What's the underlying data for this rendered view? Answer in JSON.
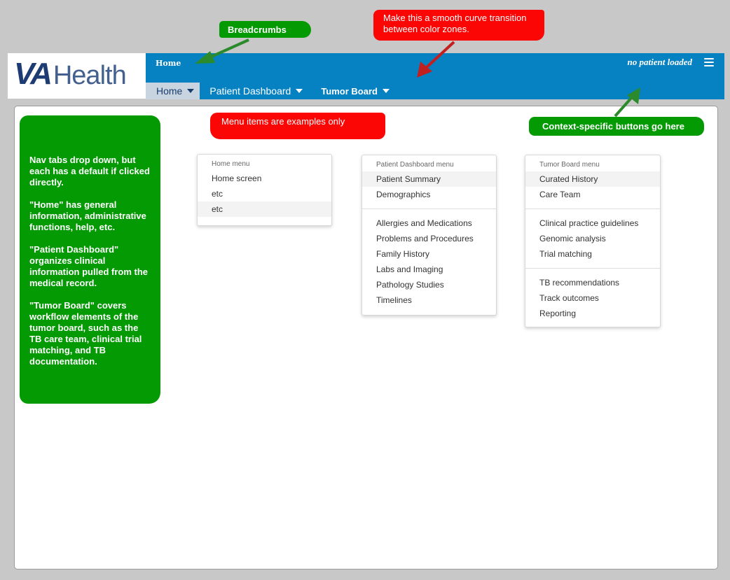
{
  "logo": {
    "va": "VA",
    "health": "Health"
  },
  "header": {
    "breadcrumb": "Home",
    "patient_status": "no patient loaded",
    "tabs": [
      {
        "label": "Home",
        "active": true
      },
      {
        "label": "Patient Dashboard"
      },
      {
        "label": "Tumor Board"
      }
    ]
  },
  "annotations": {
    "breadcrumbs": "Breadcrumbs",
    "curve": "Make this a smooth curve transition between color zones.",
    "menu_examples": "Menu items are examples only",
    "context_buttons": "Context-specific buttons go here",
    "nav_tabs": [
      "Nav tabs drop down, but each has a default if clicked directly.",
      "\"Home\" has general information, administrative functions, help, etc.",
      "\"Patient Dashboard\" organizes clinical information pulled from the medical record.",
      "\"Tumor Board\" covers workflow elements of the tumor board, such as the TB care team, clinical trial matching, and TB documentation."
    ]
  },
  "menus": {
    "home": {
      "header": "Home menu",
      "items": [
        "Home screen",
        "etc",
        "etc"
      ]
    },
    "patient_dashboard": {
      "header": "Patient Dashboard menu",
      "groups": [
        [
          "Patient Summary",
          "Demographics"
        ],
        [
          "Allergies and Medications",
          "Problems and Procedures",
          "Family History",
          "Labs and Imaging",
          "Pathology Studies",
          "Timelines"
        ]
      ]
    },
    "tumor_board": {
      "header": "Tumor Board menu",
      "groups": [
        [
          "Curated History",
          "Care Team"
        ],
        [
          "Clinical practice guidelines",
          "Genomic analysis",
          "Trial matching"
        ],
        [
          "TB recommendations",
          "Track outcomes",
          "Reporting"
        ]
      ]
    }
  },
  "colors": {
    "header_blue": "#0681c2",
    "note_green": "#049a04",
    "note_red": "#fb0505",
    "logo_navy": "#1c3c73"
  }
}
